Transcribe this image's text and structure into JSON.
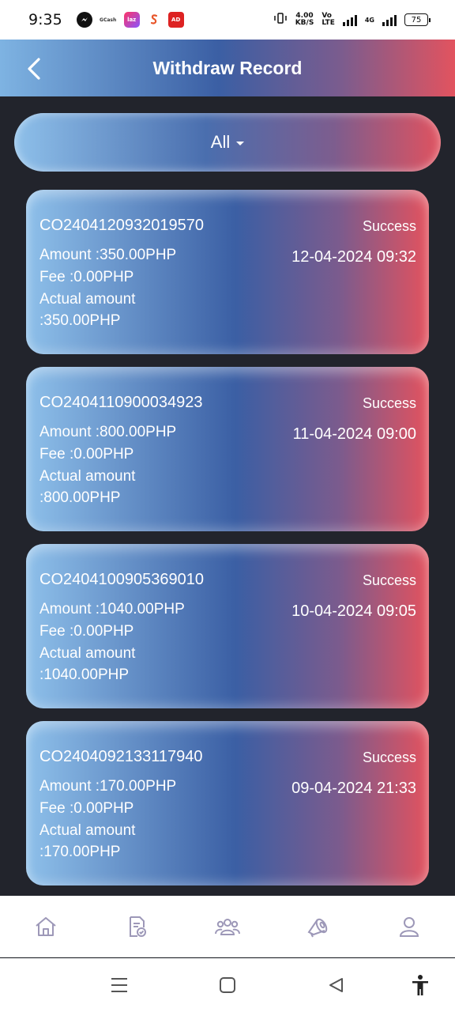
{
  "status_bar": {
    "time": "9:35",
    "speed_value": "4.00",
    "speed_unit": "KB/S",
    "volte_top": "Vo",
    "volte_bottom": "LTE",
    "network": "4G",
    "battery": "75",
    "notification_icons": [
      "messenger-icon",
      "gcash-icon",
      "lazada-icon",
      "shopee-icon",
      "ad-icon"
    ],
    "gcash_text": "GCash",
    "lazada_text": "laz",
    "ad_text": "AD"
  },
  "header": {
    "title": "Withdraw Record"
  },
  "filter": {
    "selected": "All"
  },
  "records": [
    {
      "id": "CO2404120932019570",
      "status": "Success",
      "amount": "Amount :350.00PHP",
      "date": "12-04-2024 09:32",
      "fee": "Fee :0.00PHP",
      "actual_label": "Actual amount",
      "actual_value": ":350.00PHP"
    },
    {
      "id": "CO2404110900034923",
      "status": "Success",
      "amount": "Amount :800.00PHP",
      "date": "11-04-2024 09:00",
      "fee": "Fee :0.00PHP",
      "actual_label": "Actual amount",
      "actual_value": ":800.00PHP"
    },
    {
      "id": "CO2404100905369010",
      "status": "Success",
      "amount": "Amount :1040.00PHP",
      "date": "10-04-2024 09:05",
      "fee": "Fee :0.00PHP",
      "actual_label": "Actual amount",
      "actual_value": ":1040.00PHP"
    },
    {
      "id": "CO2404092133117940",
      "status": "Success",
      "amount": "Amount :170.00PHP",
      "date": "09-04-2024 21:33",
      "fee": "Fee :0.00PHP",
      "actual_label": "Actual amount",
      "actual_value": ":170.00PHP"
    }
  ],
  "bottom_nav": [
    "home-icon",
    "records-icon",
    "team-icon",
    "promotion-icon",
    "profile-icon"
  ],
  "system_nav": [
    "menu-icon",
    "home-square-icon",
    "back-triangle-icon",
    "accessibility-icon"
  ],
  "colors": {
    "background": "#22242c",
    "gradient_light_blue": "#8ec0ea",
    "gradient_blue": "#3b5fa4",
    "gradient_red": "#e3525e",
    "nav_icon": "#9d98b8"
  }
}
